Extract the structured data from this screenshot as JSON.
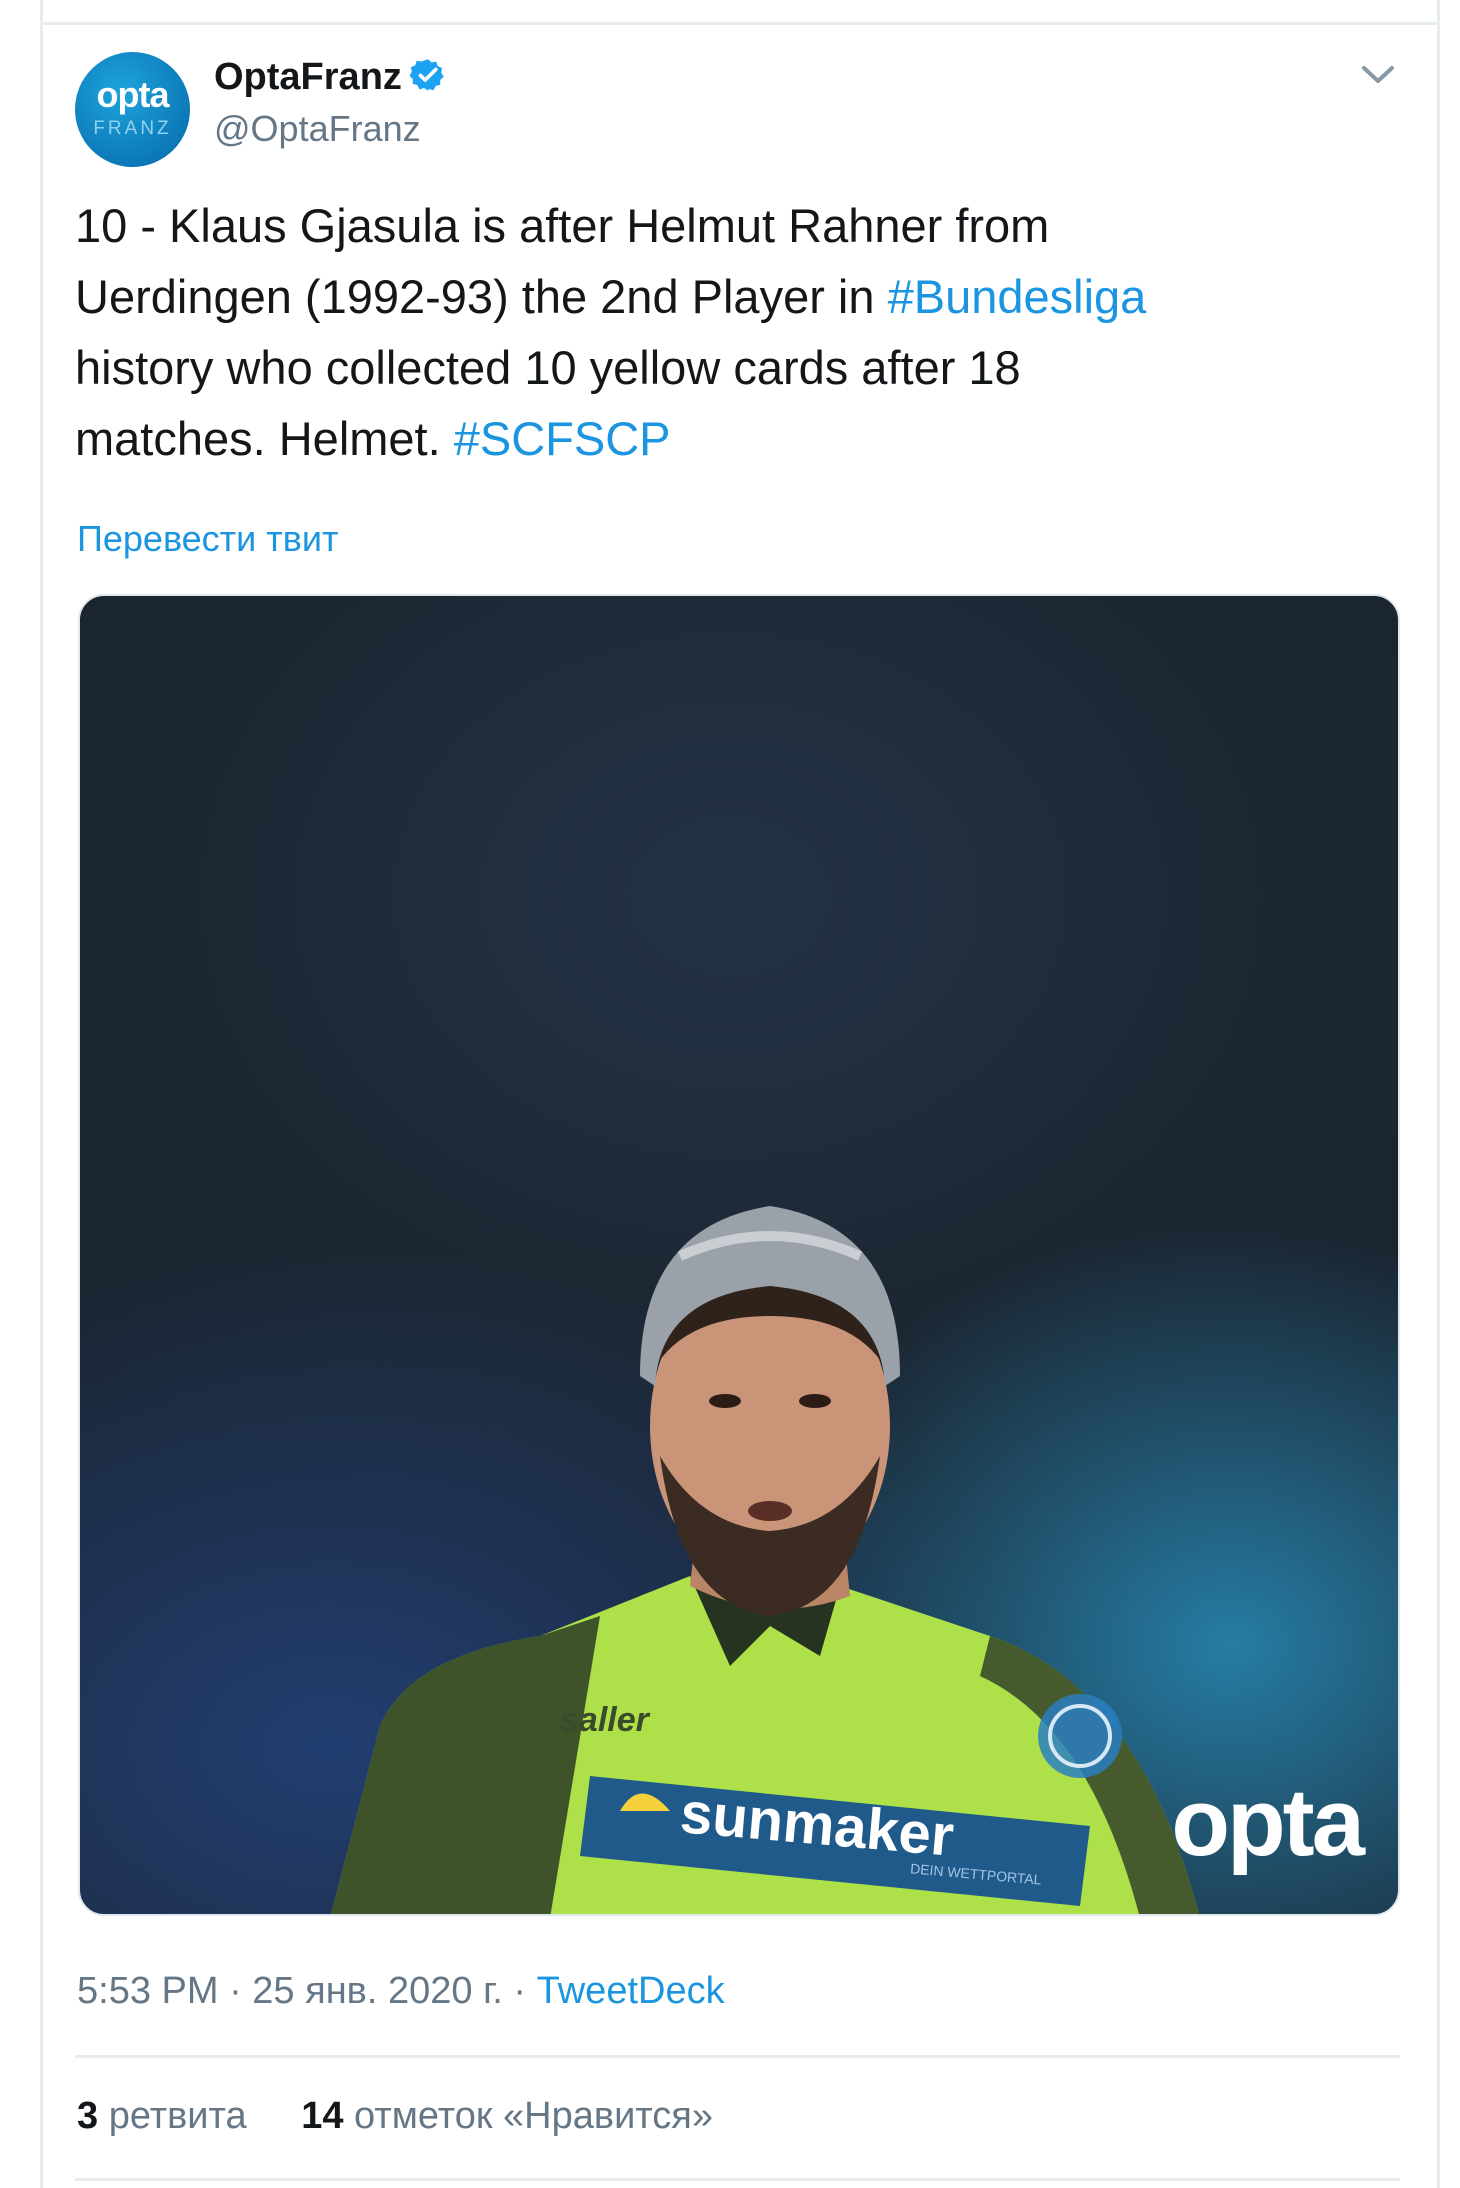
{
  "tweet": {
    "author": {
      "display_name": "OptaFranz",
      "handle": "@OptaFranz",
      "verified": true,
      "avatar_text": "opta",
      "avatar_subtext": "FRANZ"
    },
    "text_lines": [
      [
        {
          "text": "10 - Klaus Gjasula is after Helmut Rahner from",
          "type": "text"
        }
      ],
      [
        {
          "text": "Uerdingen (1992-93) the 2nd Player in ",
          "type": "text"
        },
        {
          "text": "#Bundesliga",
          "type": "hashtag"
        }
      ],
      [
        {
          "text": "history who collected 10 yellow cards after 18",
          "type": "text"
        }
      ],
      [
        {
          "text": "matches. Helmet. ",
          "type": "text"
        },
        {
          "text": "#SCFSCP",
          "type": "hashtag"
        }
      ]
    ],
    "translate_label": "Перевести твит",
    "media": {
      "description_icon": "player-photo",
      "watermark": "opta",
      "shirt_sponsor": "sunmaker",
      "shirt_sponsor_tagline": "DEIN WETTPORTAL",
      "kit_brand": "saller"
    },
    "timestamp": "5:53 PM · 25 янв. 2020 г. · ",
    "source": "TweetDeck",
    "stats": {
      "retweets_count": "3",
      "retweets_label": "ретвита",
      "likes_count": "14",
      "likes_label": "отметок «Нравится»"
    }
  },
  "colors": {
    "link": "#1b95e0",
    "secondary_text": "#657786",
    "primary_text": "#14171a",
    "divider": "#e6ecf0",
    "verified_badge": "#1da1f2"
  }
}
